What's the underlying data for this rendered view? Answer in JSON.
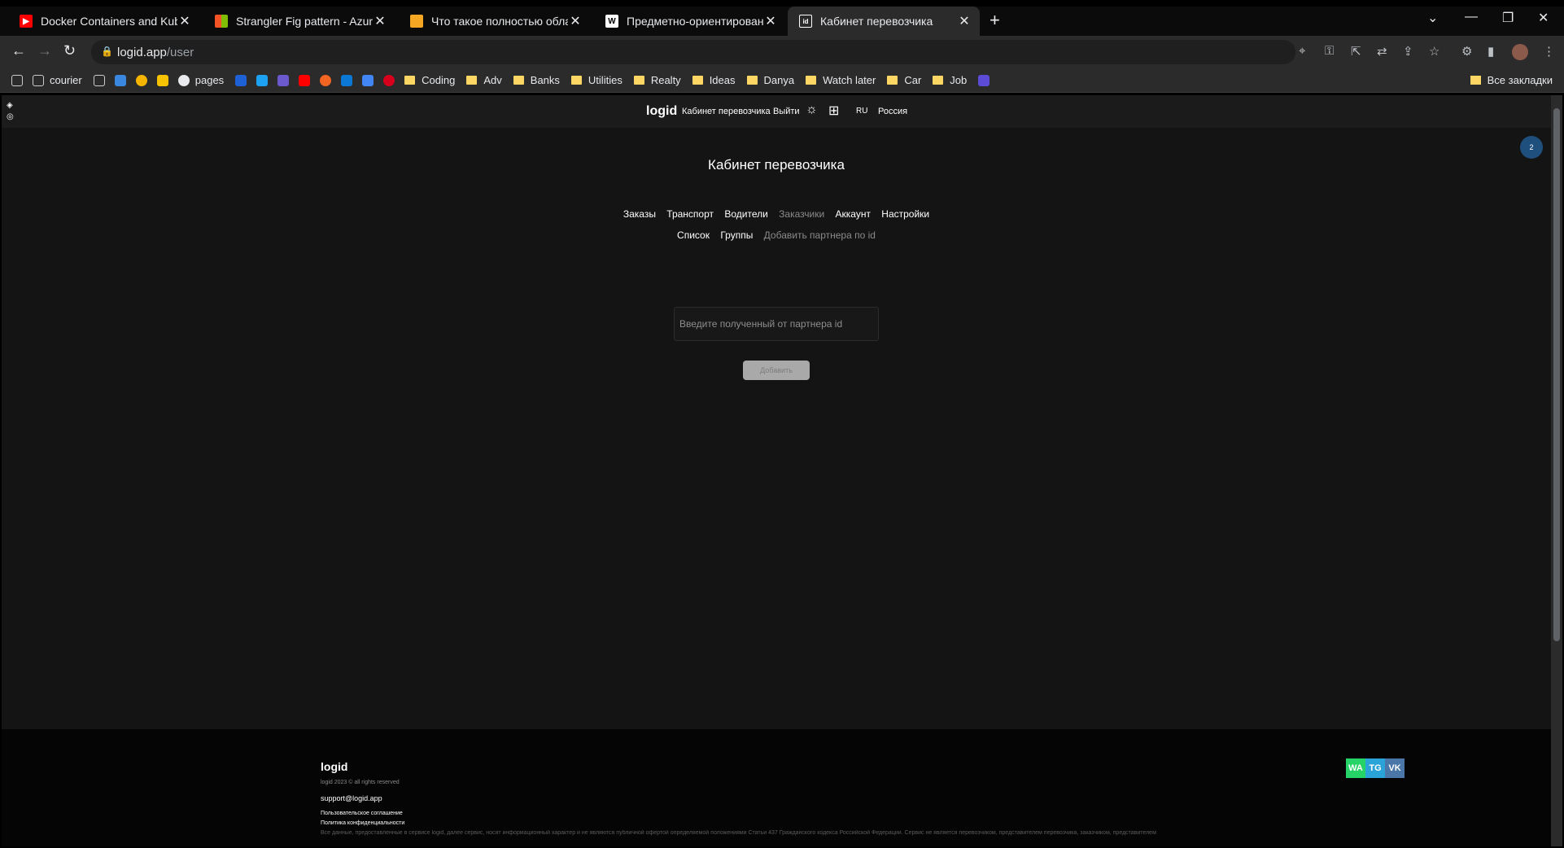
{
  "browser": {
    "tabs": [
      {
        "title": "Docker Containers and Kubernetes",
        "icon": "youtube-icon",
        "color": "#ff0000"
      },
      {
        "title": "Strangler Fig pattern - Azure Architecture",
        "icon": "microsoft-icon",
        "color": "#f35325"
      },
      {
        "title": "Что такое полностью облачная",
        "icon": "cube-icon",
        "color": "#f5a623"
      },
      {
        "title": "Предметно-ориентированное",
        "icon": "wikipedia-icon",
        "color": "#ffffff"
      },
      {
        "title": "Кабинет перевозчика",
        "icon": "logid-icon",
        "color": "#ffffff",
        "active": true
      }
    ],
    "url_host": "logid.app",
    "url_path": "/user",
    "bookmarks": [
      {
        "label": "",
        "icon": "logid-icon"
      },
      {
        "label": "courier",
        "icon": "logid-icon"
      },
      {
        "label": "",
        "icon": "logid-icon"
      },
      {
        "label": "",
        "icon": "site-icon"
      },
      {
        "label": "",
        "icon": "site-icon"
      },
      {
        "label": "",
        "icon": "site-icon"
      },
      {
        "label": "pages",
        "icon": "globe-icon"
      },
      {
        "label": "",
        "icon": "site-icon"
      },
      {
        "label": "",
        "icon": "site-icon"
      },
      {
        "label": "",
        "icon": "site-icon"
      },
      {
        "label": "",
        "icon": "youtube-icon"
      },
      {
        "label": "",
        "icon": "site-icon"
      },
      {
        "label": "",
        "icon": "onedrive-icon"
      },
      {
        "label": "",
        "icon": "translate-icon"
      },
      {
        "label": "",
        "icon": "hh-icon"
      },
      {
        "label": "Coding",
        "icon": "folder-icon"
      },
      {
        "label": "Adv",
        "icon": "folder-icon"
      },
      {
        "label": "Banks",
        "icon": "folder-icon"
      },
      {
        "label": "Utilities",
        "icon": "folder-icon"
      },
      {
        "label": "Realty",
        "icon": "folder-icon"
      },
      {
        "label": "Ideas",
        "icon": "folder-icon"
      },
      {
        "label": "Danya",
        "icon": "folder-icon"
      },
      {
        "label": "Watch later",
        "icon": "folder-icon"
      },
      {
        "label": "Car",
        "icon": "folder-icon"
      },
      {
        "label": "Job",
        "icon": "folder-icon"
      },
      {
        "label": "",
        "icon": "site-icon"
      }
    ],
    "all_bookmarks": "Все закладки"
  },
  "site": {
    "logo": "logid",
    "nav_cabinet": "Кабинет перевозчика",
    "nav_logout": "Выйти",
    "lang": "RU",
    "country": "Россия",
    "notification_count": "2"
  },
  "main": {
    "title": "Кабинет перевозчика",
    "menu": [
      {
        "label": "Заказы"
      },
      {
        "label": "Транспорт"
      },
      {
        "label": "Водители"
      },
      {
        "label": "Заказчики",
        "muted": true
      },
      {
        "label": "Аккаунт"
      },
      {
        "label": "Настройки"
      }
    ],
    "submenu": [
      {
        "label": "Список"
      },
      {
        "label": "Группы"
      },
      {
        "label": "Добавить партнера по id",
        "muted": true
      }
    ],
    "input_placeholder": "Введите полученный от партнера id",
    "add_button": "Добавить"
  },
  "footer": {
    "logo": "logid",
    "copyright": "logid 2023 © all rights reserved",
    "email": "support@logid.app",
    "terms": "Пользовательское соглашение",
    "privacy": "Политика конфиденциальности",
    "legal": "Все данные, предоставленные в сервисе logid, далее сервис, носят информационный характер и не являются публичной офертой определяемой положениями Статьи 437 Гражданского кодекса Российской Федерации. Сервис не является перевозчиком, представителем перевозчика, заказчиком, представителем",
    "social": [
      {
        "name": "whatsapp",
        "label": "WA",
        "color": "#25d366"
      },
      {
        "name": "telegram",
        "label": "TG",
        "color": "#2aa3d8"
      },
      {
        "name": "vk",
        "label": "VK",
        "color": "#4a76a8"
      }
    ]
  }
}
